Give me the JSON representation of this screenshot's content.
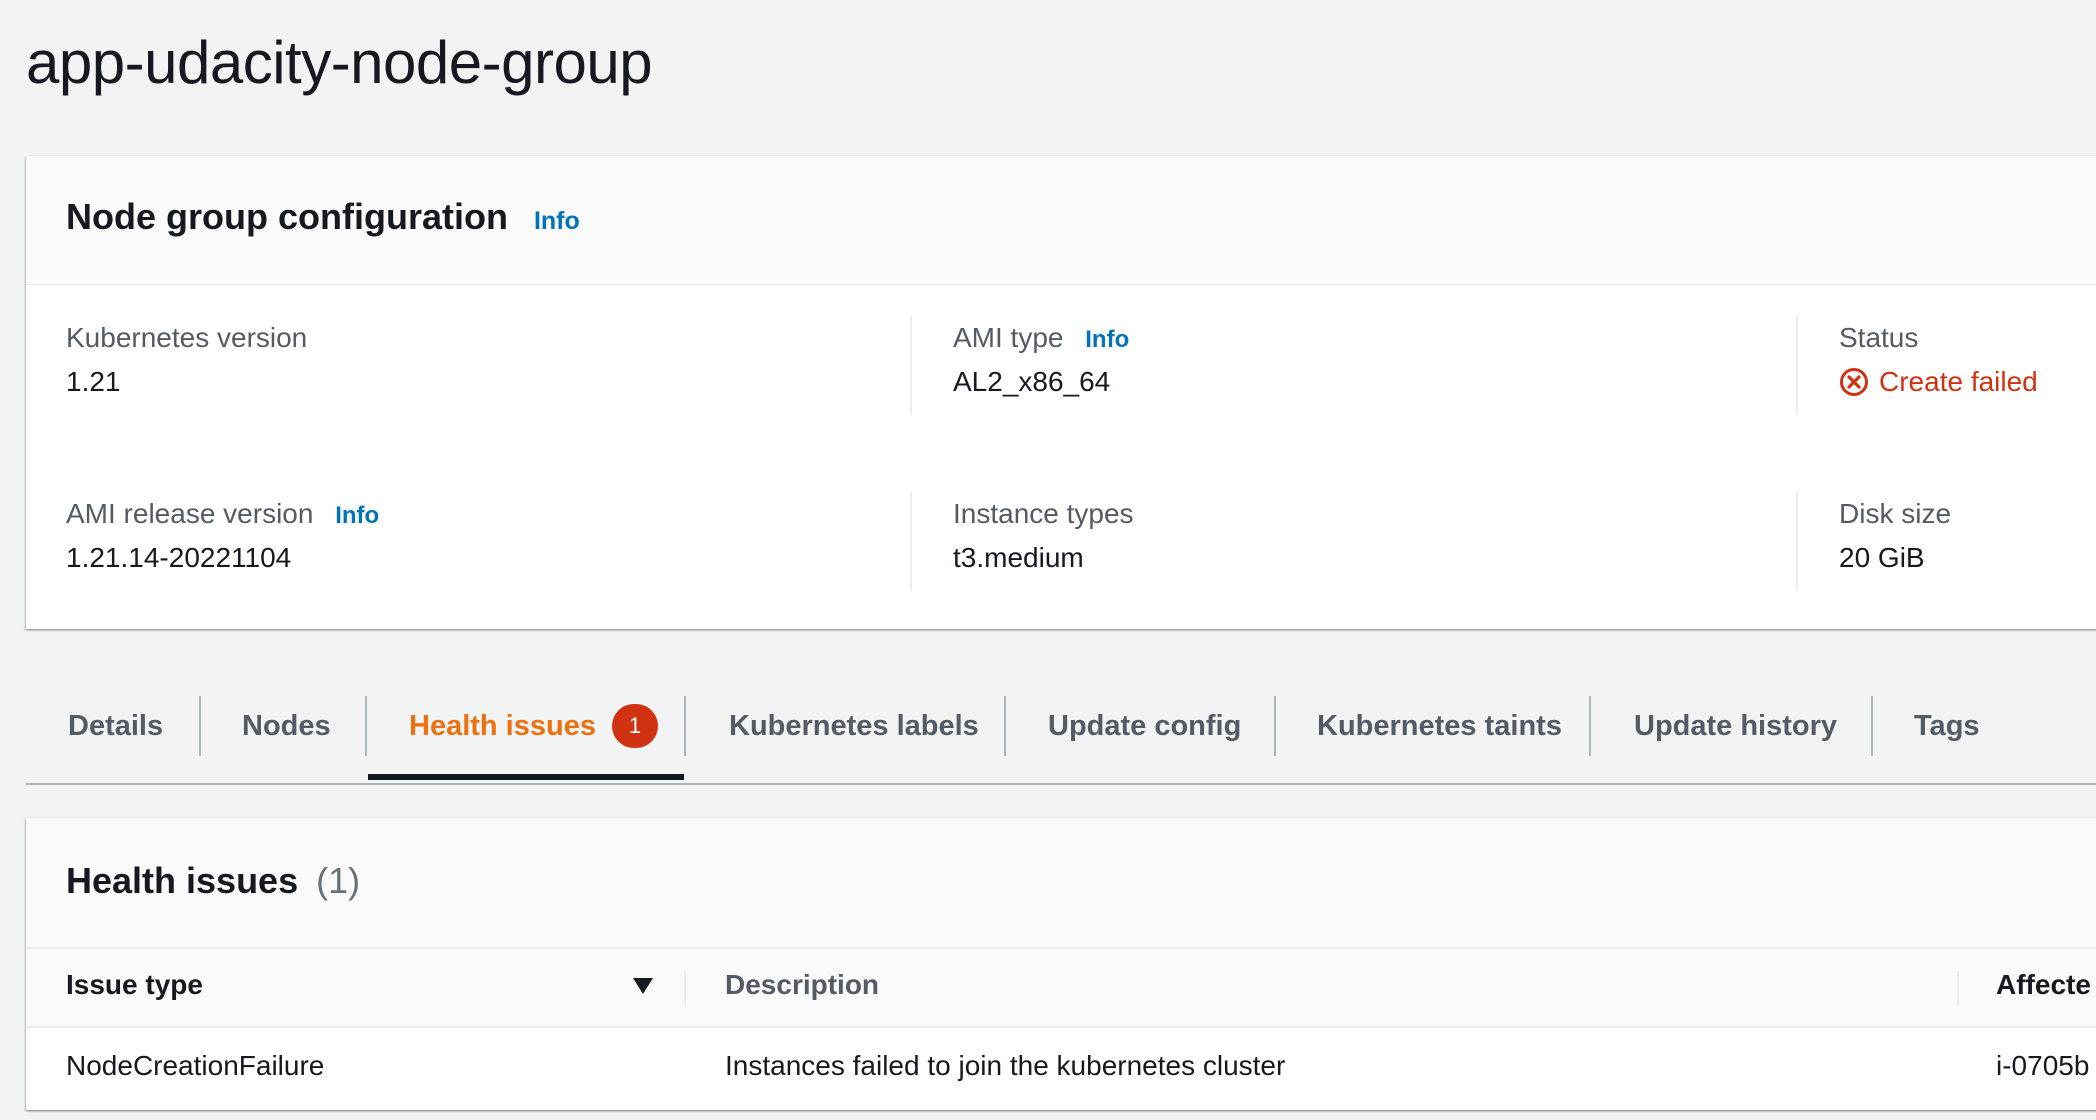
{
  "page": {
    "title": "app-udacity-node-group"
  },
  "config": {
    "title": "Node group configuration",
    "info_label": "Info",
    "kubernetes_version": {
      "label": "Kubernetes version",
      "value": "1.21"
    },
    "ami_type": {
      "label": "AMI type",
      "info": "Info",
      "value": "AL2_x86_64"
    },
    "status": {
      "label": "Status",
      "value": "Create failed",
      "icon": "error-circle-x-icon",
      "color": "#d13212"
    },
    "ami_release_version": {
      "label": "AMI release version",
      "info": "Info",
      "value": "1.21.14-20221104"
    },
    "instance_types": {
      "label": "Instance types",
      "value": "t3.medium"
    },
    "disk_size": {
      "label": "Disk size",
      "value": "20 GiB"
    }
  },
  "tabs": {
    "items": [
      {
        "label": "Details"
      },
      {
        "label": "Nodes"
      },
      {
        "label": "Health issues",
        "badge": "1",
        "active": true
      },
      {
        "label": "Kubernetes labels"
      },
      {
        "label": "Update config"
      },
      {
        "label": "Kubernetes taints"
      },
      {
        "label": "Update history"
      },
      {
        "label": "Tags"
      }
    ],
    "active_color": "#ec7211"
  },
  "health": {
    "title": "Health issues",
    "count": "(1)",
    "columns": [
      "Issue type",
      "Description",
      "Affecte"
    ],
    "rows": [
      {
        "issue_type": "NodeCreationFailure",
        "description": "Instances failed to join the kubernetes cluster",
        "affected": "i-0705b"
      }
    ]
  }
}
